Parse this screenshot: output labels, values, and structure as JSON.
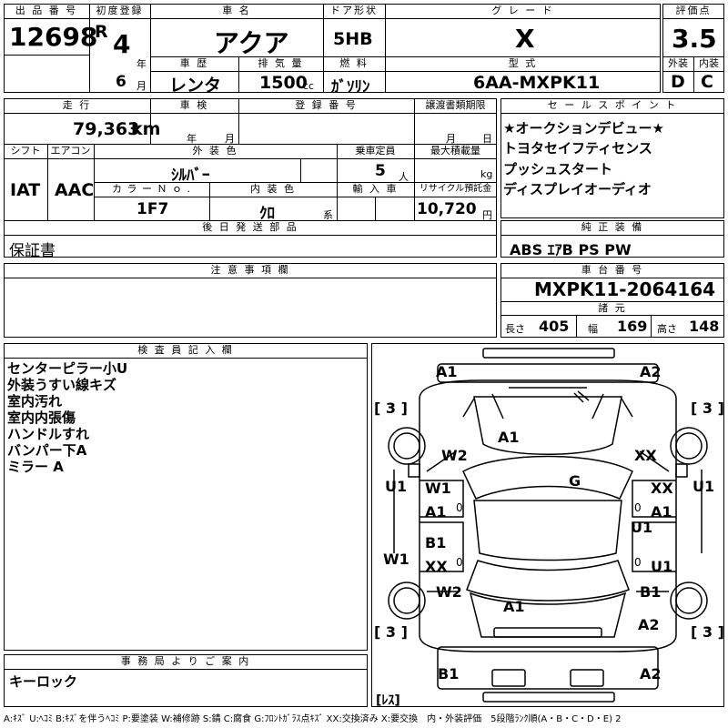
{
  "header": {
    "lot_label": "出 品 番 号",
    "lot_no": "12698",
    "first_reg_label": "初度登録",
    "era": "R",
    "year_num": "4",
    "year_unit": "年",
    "month_num": "6",
    "month_unit": "月",
    "car_name_label": "車 名",
    "car_name": "アクア",
    "door_label": "ドア形状",
    "door_type": "5HB",
    "grade_label": "グ レ ー ド",
    "grade": "X",
    "score_label": "評価点",
    "score": "3.5",
    "history_label": "車 歴",
    "history": "レンタ",
    "displacement_label": "排 気 量",
    "displacement": "1500",
    "displacement_unit": "cc",
    "fuel_label": "燃 料",
    "fuel": "ｶﾞｿﾘﾝ",
    "model_label": "型 式",
    "model": "6AA-MXPK11",
    "ext_label": "外装",
    "ext_grade": "D",
    "int_label": "内装",
    "int_grade": "C"
  },
  "row2": {
    "mileage_label": "走 行",
    "mileage": "79,363",
    "mileage_unit": "km",
    "shaken_label": "車 検",
    "shaken_year_unit": "年",
    "shaken_month_unit": "月",
    "reg_no_label": "登 録 番 号",
    "transfer_label": "譲渡書類期限",
    "transfer_month_unit": "月",
    "transfer_day_unit": "日",
    "shift_label": "シフト",
    "shift": "IAT",
    "ac_label": "エアコン",
    "ac": "AAC",
    "color_label": "外 装 色",
    "color": "ｼﾙﾊﾞｰ",
    "capacity_label": "乗車定員",
    "capacity": "5",
    "capacity_unit": "人",
    "maxload_label": "最大積載量",
    "maxload_unit": "kg",
    "colorno_label": "カ ラ ー Ｎ ｏ .",
    "colorno": "1F7",
    "interior_label": "内 装 色",
    "interior": "ｸﾛ",
    "interior_unit": "系",
    "import_label": "輸 入 車",
    "recycle_label": "リサイクル預託金",
    "recycle": "10,720",
    "recycle_unit": "円",
    "later_label": "後 日 発 送 部 品",
    "later": "保証書"
  },
  "sales": {
    "label": "セ ー ル ス ポ イ ン ト",
    "items": [
      "★オークションデビュー★",
      "トヨタセイフティセンス",
      "プッシュスタート",
      "ディスプレイオーディオ"
    ]
  },
  "options": {
    "label": "純 正 装 備",
    "value": "ABS ｴｱB PS PW"
  },
  "caution": {
    "label": "注 意 事 項 欄"
  },
  "chassis": {
    "label": "車 台 番 号",
    "value": "MXPK11-2064164",
    "dims_label": "諸 元",
    "length_label": "長さ",
    "length": "405",
    "width_label": "幅",
    "width": "169",
    "height_label": "高さ",
    "height": "148"
  },
  "inspector": {
    "label": "検 査 員 記 入 欄",
    "lines": [
      "センターピラー小U",
      "外装うすい線キズ",
      "室内汚れ",
      "室内内張傷",
      "ハンドルすれ",
      "バンパー下A",
      "ミラー A"
    ]
  },
  "office": {
    "label": "事 務 局 よ り ご 案 内",
    "value": "キーロック"
  },
  "diagram": {
    "marks": {
      "front_bumper_left": "A1",
      "front_bumper_right": "A2",
      "tire_fl": "3",
      "tire_fr": "3",
      "tire_rl": "3",
      "tire_rr": "3",
      "hood": "A1",
      "fender_fl": "W2",
      "fender_fr": "XX",
      "roof": "G",
      "door_fl_top": "W1",
      "door_fl_bot": "A1",
      "door_fr_top": "XX",
      "door_fr_bot": "A1",
      "door_fr_mid": "U1",
      "rocker_left_top": "U1",
      "rocker_right_top": "U1",
      "door_rl_top": "B1",
      "door_rl_bot": "XX",
      "rocker_left_bot": "W1",
      "door_rr": "U1",
      "quarter_rl": "W2",
      "quarter_rr": "B1",
      "trunk": "A1",
      "rear_right_corner": "A2",
      "rear_bumper_left": "B1",
      "rear_bumper_right": "A2",
      "spare": "ﾚｽ",
      "left_pillar_mark": "0",
      "right_pillar_mark": "0",
      "left_lower_mark": "0",
      "right_lower_mark": "0"
    }
  },
  "legend": "A:ｷｽﾞ U:ﾍｺﾐ B:ｷｽﾞを伴うﾍｺﾐ P:要塗装 W:補修跡 S:錆 C:腐食 G:ﾌﾛﾝﾄｶﾞﾗｽ点ｷｽﾞ XX:交換済み X:要交換　内・外装評価　5段階ﾗﾝｸ順(A・B・C・D・E) 2"
}
